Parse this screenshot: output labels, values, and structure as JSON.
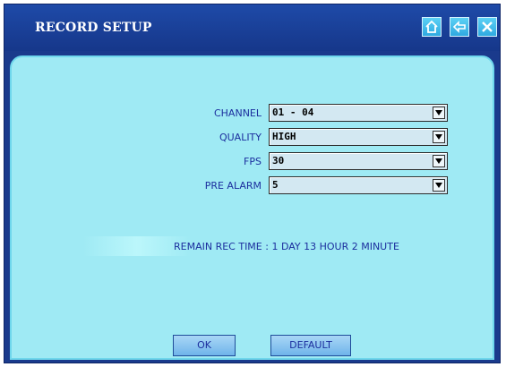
{
  "window": {
    "title": "RECORD SETUP",
    "buttons": [
      {
        "name": "home",
        "icon": "home-icon"
      },
      {
        "name": "back",
        "icon": "arrow-left-icon"
      },
      {
        "name": "close",
        "icon": "close-icon"
      }
    ]
  },
  "form": {
    "fields": [
      {
        "label": "CHANNEL",
        "value": "01 - 04"
      },
      {
        "label": "QUALITY",
        "value": "HIGH"
      },
      {
        "label": "FPS",
        "value": "30"
      },
      {
        "label": "PRE ALARM",
        "value": "5"
      }
    ],
    "remain_text": "REMAIN REC TIME : 1 DAY 13 HOUR 2 MINUTE"
  },
  "footer": {
    "ok_label": "OK",
    "default_label": "DEFAULT"
  },
  "colors": {
    "frame": "#1a3a8c",
    "panel": "#9feaf4",
    "label_text": "#1c2f9e",
    "titlebar_button": "#2fa9e0"
  }
}
